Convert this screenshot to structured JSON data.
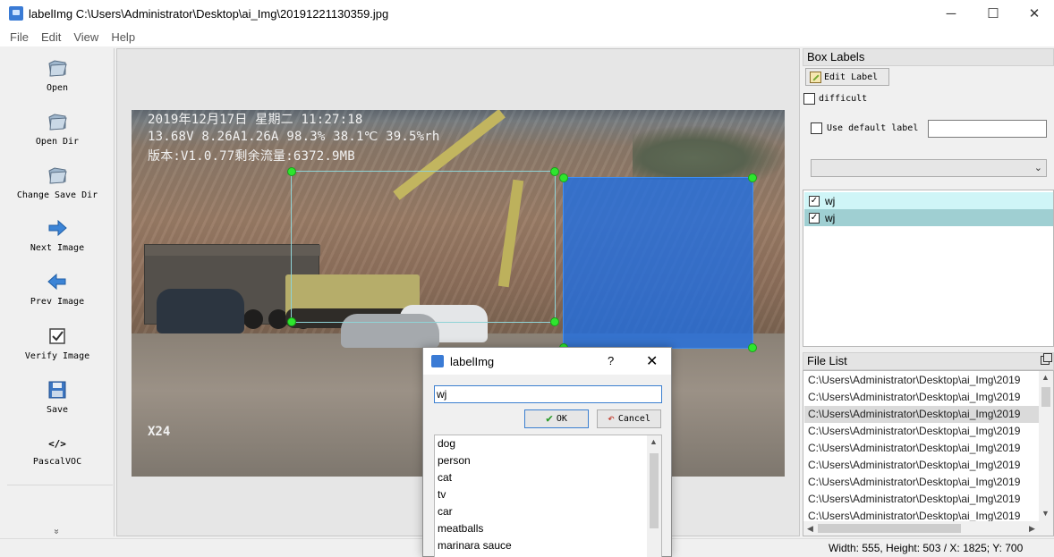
{
  "window": {
    "title": "labelImg C:\\Users\\Administrator\\Desktop\\ai_Img\\20191221130359.jpg",
    "controls": [
      "─",
      "☐",
      "✕"
    ]
  },
  "menu": [
    "File",
    "Edit",
    "View",
    "Help"
  ],
  "toolbar": {
    "items": [
      {
        "label": "Open",
        "icon": "folder-icon"
      },
      {
        "label": "Open Dir",
        "icon": "folder-icon"
      },
      {
        "label": "Change Save Dir",
        "icon": "folder-icon"
      },
      {
        "label": "Next Image",
        "icon": "arrow-right-icon"
      },
      {
        "label": "Prev Image",
        "icon": "arrow-left-icon"
      },
      {
        "label": "Verify Image",
        "icon": "checkbox-icon"
      },
      {
        "label": "Save",
        "icon": "floppy-icon"
      },
      {
        "label": "PascalVOC",
        "icon": "code-icon"
      }
    ],
    "code_glyph": "</>",
    "more": "»"
  },
  "canvas": {
    "osd_line1": "2019年12月17日  星期二  11:27:18",
    "osd_line2": "13.68V 8.26A1.26A 98.3% 38.1℃ 39.5%rh",
    "osd_line3": "版本:V1.0.77剩余流量:6372.9MB",
    "zoom_text": "X24",
    "bbox_fill_color": "#1e6ee6",
    "handle_color": "#2ee62e"
  },
  "box_labels": {
    "title": "Box Labels",
    "edit_label": "Edit Label",
    "difficult": "difficult",
    "use_default_label": "Use default label",
    "default_label_value": "",
    "labels": [
      {
        "name": "wj",
        "checked": true
      },
      {
        "name": "wj",
        "checked": true
      }
    ]
  },
  "file_list": {
    "title": "File List",
    "files": [
      "C:\\Users\\Administrator\\Desktop\\ai_Img\\2019",
      "C:\\Users\\Administrator\\Desktop\\ai_Img\\2019",
      "C:\\Users\\Administrator\\Desktop\\ai_Img\\2019",
      "C:\\Users\\Administrator\\Desktop\\ai_Img\\2019",
      "C:\\Users\\Administrator\\Desktop\\ai_Img\\2019",
      "C:\\Users\\Administrator\\Desktop\\ai_Img\\2019",
      "C:\\Users\\Administrator\\Desktop\\ai_Img\\2019",
      "C:\\Users\\Administrator\\Desktop\\ai_Img\\2019",
      "C:\\Users\\Administrator\\Desktop\\ai_Img\\2019"
    ],
    "selected_index": 2
  },
  "status": {
    "text": "Width: 555, Height: 503 / X: 1825; Y: 700"
  },
  "dialog": {
    "title": "labelImg",
    "help": "?",
    "close": "✕",
    "input_value": "wj",
    "ok": "OK",
    "cancel": "Cancel",
    "items": [
      "dog",
      "person",
      "cat",
      "tv",
      "car",
      "meatballs",
      "marinara sauce"
    ]
  }
}
